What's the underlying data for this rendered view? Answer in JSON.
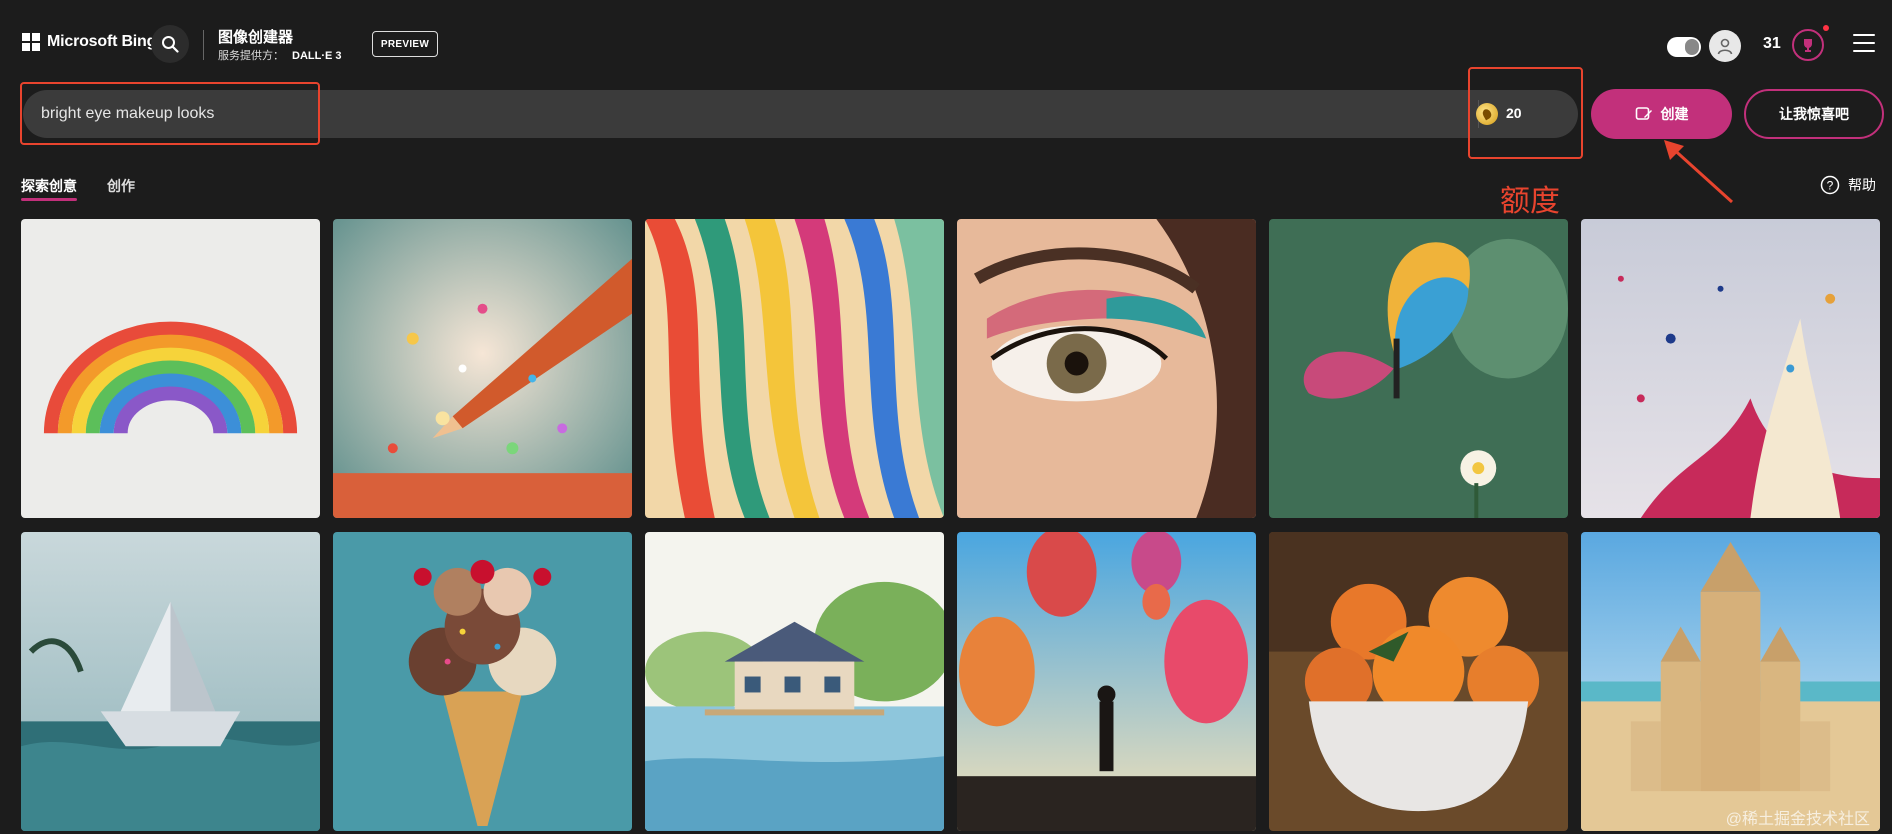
{
  "header": {
    "brand": "Microsoft Bing",
    "title": "图像创建器",
    "subtitle_prefix": "服务提供方：",
    "subtitle_provider": "DALL·E 3",
    "preview_badge": "PREVIEW",
    "rewards_count": "31"
  },
  "prompt": {
    "value": "bright eye makeup looks",
    "boosts": "20",
    "create_label": "创建",
    "surprise_label": "让我惊喜吧"
  },
  "annotation": {
    "label": "额度"
  },
  "tabs": [
    {
      "label": "探索创意",
      "active": true
    },
    {
      "label": "创作",
      "active": false
    }
  ],
  "help": {
    "label": "帮助"
  },
  "gallery": {
    "items": [
      {
        "icon": "rainbow-image"
      },
      {
        "icon": "pencil-glitter-image"
      },
      {
        "icon": "ribbons-image"
      },
      {
        "icon": "eye-makeup-image"
      },
      {
        "icon": "butterfly-image"
      },
      {
        "icon": "paint-splash-image"
      },
      {
        "icon": "paper-boat-image"
      },
      {
        "icon": "ice-cream-image"
      },
      {
        "icon": "lake-house-image"
      },
      {
        "icon": "balloons-image"
      },
      {
        "icon": "oranges-bowl-image"
      },
      {
        "icon": "sandcastle-image"
      }
    ],
    "watermark": "@稀土掘金技术社区"
  },
  "colors": {
    "accent": "#c2307b",
    "annotation": "#e8442e",
    "background": "#1c1c1c"
  }
}
